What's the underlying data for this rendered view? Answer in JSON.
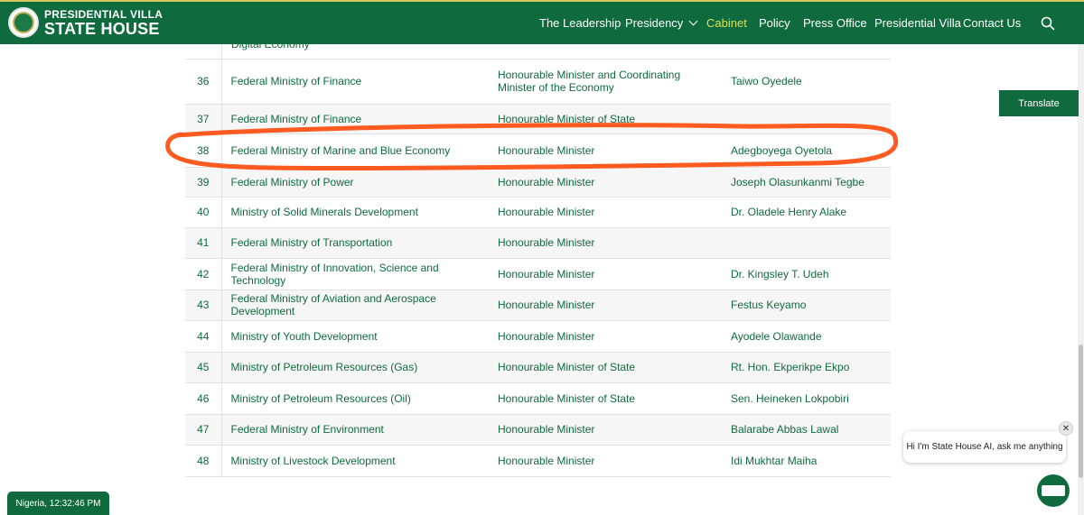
{
  "header": {
    "brand_line1": "PRESIDENTIAL VILLA",
    "brand_line2": "STATE HOUSE",
    "nav": [
      {
        "label": "The Leadership"
      },
      {
        "label": "Presidency"
      },
      {
        "label": "Cabinet"
      },
      {
        "label": "Policy"
      },
      {
        "label": "Press Office"
      },
      {
        "label": "Presidential Villa"
      },
      {
        "label": "Contact Us"
      }
    ],
    "active_nav": "Cabinet",
    "search_icon": "search-icon"
  },
  "table": {
    "partial_row_text": "Digital Economy",
    "rows": [
      {
        "num": "36",
        "ministry": "Federal Ministry of Finance",
        "position": "Honourable Minister and Coordinating Minister of the Economy",
        "name": "Taiwo Oyedele"
      },
      {
        "num": "37",
        "ministry": "Federal Ministry of Finance",
        "position": "Honourable Minister of State",
        "name": ""
      },
      {
        "num": "38",
        "ministry": "Federal Ministry of Marine and Blue Economy",
        "position": "Honourable Minister",
        "name": "Adegboyega Oyetola"
      },
      {
        "num": "39",
        "ministry": "Federal Ministry of Power",
        "position": "Honourable Minister",
        "name": "Joseph Olasunkanmi Tegbe"
      },
      {
        "num": "40",
        "ministry": "Ministry of Solid Minerals Development",
        "position": "Honourable Minister",
        "name": "Dr. Oladele Henry Alake"
      },
      {
        "num": "41",
        "ministry": "Federal Ministry of Transportation",
        "position": "Honourable Minister",
        "name": ""
      },
      {
        "num": "42",
        "ministry": "Federal Ministry of Innovation, Science and Technology",
        "position": "Honourable Minister",
        "name": "Dr. Kingsley T. Udeh"
      },
      {
        "num": "43",
        "ministry": "Federal Ministry of Aviation and Aerospace Development",
        "position": "Honourable Minister",
        "name": "Festus Keyamo"
      },
      {
        "num": "44",
        "ministry": "Ministry of Youth Development",
        "position": "Honourable Minister",
        "name": "Ayodele Olawande"
      },
      {
        "num": "45",
        "ministry": "Ministry of Petroleum Resources (Gas)",
        "position": "Honourable Minister of State",
        "name": "Rt. Hon. Ekperikpe Ekpo"
      },
      {
        "num": "46",
        "ministry": "Ministry of Petroleum Resources (Oil)",
        "position": "Honourable Minister of State",
        "name": "Sen. Heineken Lokpobiri"
      },
      {
        "num": "47",
        "ministry": "Federal Ministry of Environment",
        "position": "Honourable Minister",
        "name": "Balarabe Abbas Lawal"
      },
      {
        "num": "48",
        "ministry": "Ministry of Livestock Development",
        "position": "Honourable Minister",
        "name": "Idi Mukhtar Maiha"
      }
    ]
  },
  "translate_label": "Translate",
  "chat": {
    "bubble_text": "Hi I'm State House AI, ask me anything",
    "close_label": "✕"
  },
  "clock_text": "Nigeria, 12:32:46 PM",
  "colors": {
    "brand_green": "#0f6b3d",
    "active_nav": "#d6e05c",
    "annotation": "#ff5a1f"
  }
}
